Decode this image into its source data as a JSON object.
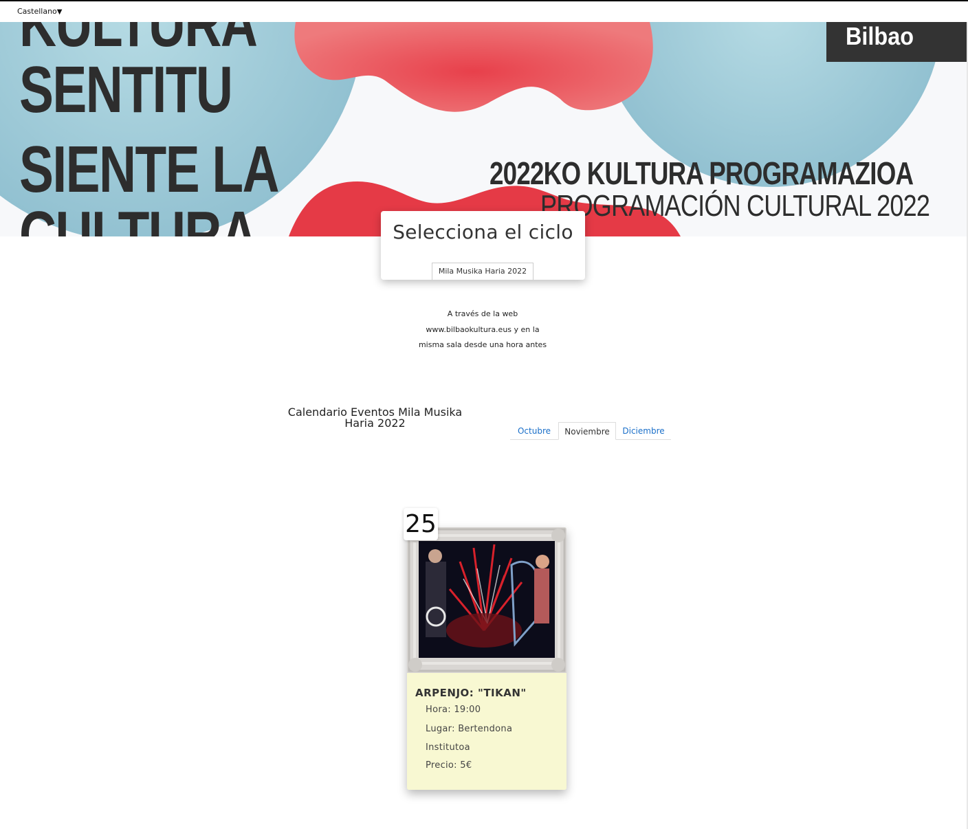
{
  "topbar": {
    "language": "Castellano",
    "dropdown_glyph": "▼"
  },
  "banner": {
    "line1": "KULTURA",
    "line2": "SENTITU",
    "line3": "SIENTE LA",
    "line4": "CULTURA",
    "program_eu": "2022KO KULTURA PROGRAMAZIOA",
    "program_es": "PROGRAMACIÓN CULTURAL 2022",
    "logo": "Bilbao"
  },
  "selector": {
    "title": "Selecciona el ciclo",
    "cycle": "Mila Musika Haria 2022"
  },
  "info": {
    "line1": "A través de la web",
    "line2": "www.bilbaokultura.eus y en la",
    "line3": "misma sala desde una hora antes"
  },
  "calendar": {
    "title_line1": "Calendario Eventos Mila Musika",
    "title_line2": "Haria 2022",
    "tabs": [
      {
        "label": "Octubre"
      },
      {
        "label": "Noviembre"
      },
      {
        "label": "Diciembre"
      }
    ],
    "active_tab": "Noviembre"
  },
  "event": {
    "day": "25",
    "title": "ARPENJO: \"TIKAN\"",
    "hora": "Hora: 19:00",
    "lugar1": "Lugar: Bertendona",
    "lugar2": "Institutoa",
    "precio": "Precio: 5€"
  },
  "colors": {
    "banner_blue": "#9ac7d5",
    "banner_red": "#e8404b",
    "card_bg": "#f8f8d2",
    "link_blue": "#1a6fc9"
  }
}
